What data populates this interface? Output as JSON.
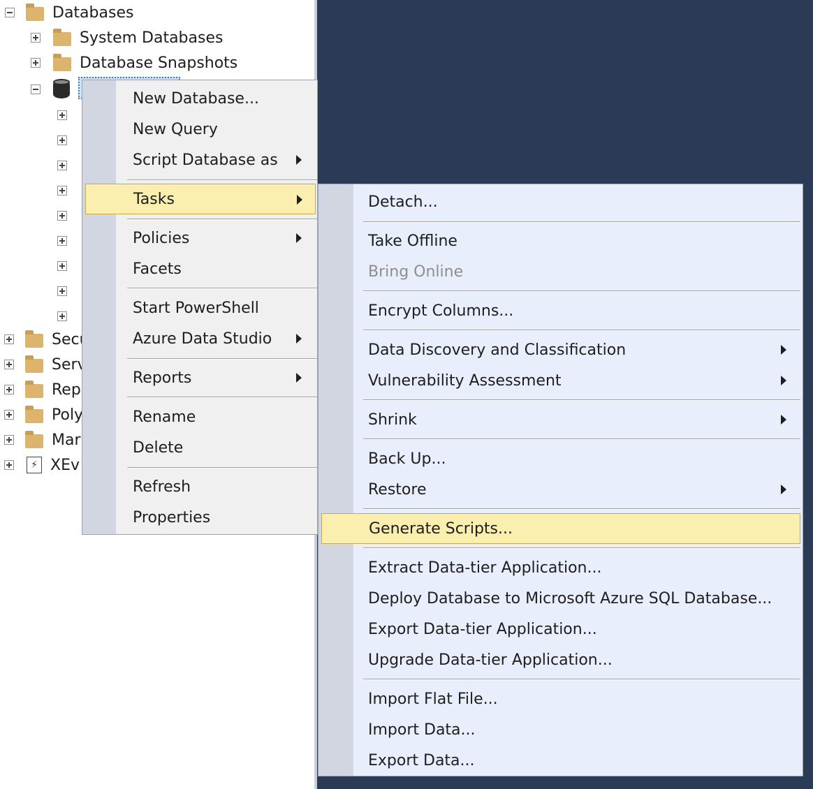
{
  "tree": {
    "root": {
      "label": "Databases",
      "icon": "folder-icon"
    },
    "children": [
      {
        "label": "System Databases",
        "icon": "folder-icon"
      },
      {
        "label": "Database Snapshots",
        "icon": "folder-icon"
      }
    ],
    "truncated_nodes": [
      {
        "label": "Secu",
        "icon": "folder-icon"
      },
      {
        "label": "Serv",
        "icon": "folder-icon"
      },
      {
        "label": "Rep",
        "icon": "folder-icon"
      },
      {
        "label": "Poly",
        "icon": "folder-icon"
      },
      {
        "label": "Mar",
        "icon": "folder-icon"
      },
      {
        "label": "XEv",
        "icon": "xevent-icon"
      }
    ]
  },
  "context_menu": {
    "items": [
      {
        "label": "New Database..."
      },
      {
        "label": "New Query"
      },
      {
        "label": "Script Database as",
        "submenu": true
      },
      {
        "label": "Tasks",
        "submenu": true,
        "highlighted": true
      },
      {
        "label": "Policies",
        "submenu": true
      },
      {
        "label": "Facets"
      },
      {
        "label": "Start PowerShell"
      },
      {
        "label": "Azure Data Studio",
        "submenu": true
      },
      {
        "label": "Reports",
        "submenu": true
      },
      {
        "label": "Rename"
      },
      {
        "label": "Delete"
      },
      {
        "label": "Refresh"
      },
      {
        "label": "Properties"
      }
    ]
  },
  "tasks_menu": {
    "items": [
      {
        "label": "Detach..."
      },
      {
        "label": "Take Offline"
      },
      {
        "label": "Bring Online",
        "disabled": true
      },
      {
        "label": "Encrypt Columns..."
      },
      {
        "label": "Data Discovery and Classification",
        "submenu": true
      },
      {
        "label": "Vulnerability Assessment",
        "submenu": true
      },
      {
        "label": "Shrink",
        "submenu": true
      },
      {
        "label": "Back Up..."
      },
      {
        "label": "Restore",
        "submenu": true
      },
      {
        "label": "Generate Scripts...",
        "highlighted": true
      },
      {
        "label": "Extract Data-tier Application..."
      },
      {
        "label": "Deploy Database to Microsoft Azure SQL Database..."
      },
      {
        "label": "Export Data-tier Application..."
      },
      {
        "label": "Upgrade Data-tier Application..."
      },
      {
        "label": "Import Flat File..."
      },
      {
        "label": "Import Data..."
      },
      {
        "label": "Export Data..."
      }
    ]
  },
  "colors": {
    "background_pane": "#2b3a55",
    "highlight": "#fbefb0",
    "folder": "#dcb46e"
  }
}
